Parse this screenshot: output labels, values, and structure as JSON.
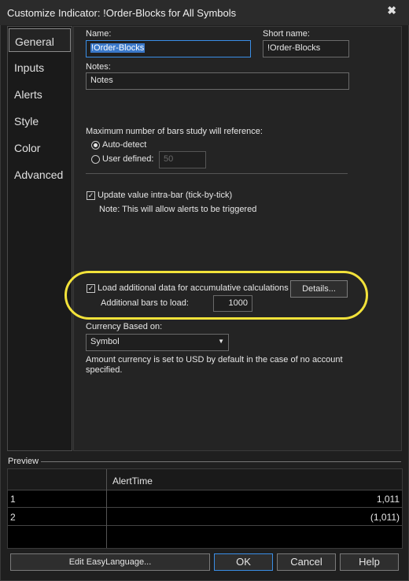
{
  "window": {
    "title": "Customize Indicator: !Order-Blocks for All Symbols",
    "close_glyph": "✖"
  },
  "nav": {
    "items": [
      {
        "label": "General",
        "active": true
      },
      {
        "label": "Inputs"
      },
      {
        "label": "Alerts"
      },
      {
        "label": "Style"
      },
      {
        "label": "Color"
      },
      {
        "label": "Advanced"
      }
    ]
  },
  "general": {
    "name_label": "Name:",
    "name_value": "!Order-Blocks",
    "short_name_label": "Short name:",
    "short_name_value": "!Order-Blocks",
    "notes_label": "Notes:",
    "notes_value": "Notes",
    "max_bars_label": "Maximum number of bars study will reference:",
    "auto_detect_label": "Auto-detect",
    "user_defined_label": "User defined:",
    "user_defined_value": "50",
    "update_intrabar_label": "Update value intra-bar (tick-by-tick)",
    "update_intrabar_note": "Note: This will allow alerts to be triggered",
    "load_additional_label": "Load additional data for accumulative calculations",
    "details_button": "Details...",
    "additional_bars_label": "Additional bars to load:",
    "additional_bars_value": "1000",
    "currency_label": "Currency Based on:",
    "currency_value": "Symbol",
    "currency_note_line1": "Amount currency is set to USD by default in the case of no account",
    "currency_note_line2": "specified."
  },
  "preview": {
    "label": "Preview",
    "column_header": "AlertTime",
    "rows": [
      {
        "num": "1",
        "value": "1,011"
      },
      {
        "num": "2",
        "value": "(1,011)"
      }
    ]
  },
  "buttons": {
    "edit": "Edit EasyLanguage...",
    "ok": "OK",
    "cancel": "Cancel",
    "help": "Help"
  },
  "colors": {
    "highlight": "#f2e23a",
    "focus": "#3a8ee6",
    "selection": "#3a78c9"
  }
}
